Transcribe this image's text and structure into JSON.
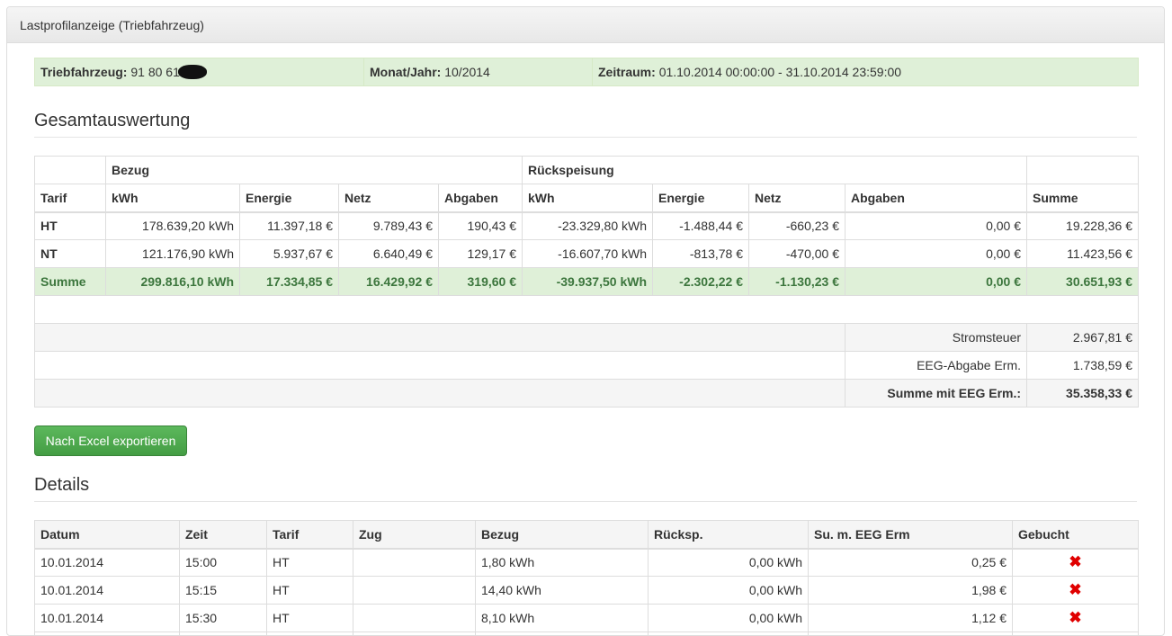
{
  "panel": {
    "title": "Lastprofilanzeige (Triebfahrzeug)"
  },
  "info": {
    "vehicle_label": "Triebfahrzeug:",
    "vehicle_value": "91 80 61",
    "month_label": "Monat/Jahr:",
    "month_value": "10/2014",
    "period_label": "Zeitraum:",
    "period_value": "01.10.2014 00:00:00 - 31.10.2014 23:59:00"
  },
  "summary": {
    "heading": "Gesamtauswertung",
    "group_headers": {
      "bezug": "Bezug",
      "rueck": "Rückspeisung"
    },
    "columns": [
      "Tarif",
      "kWh",
      "Energie",
      "Netz",
      "Abgaben",
      "kWh",
      "Energie",
      "Netz",
      "Abgaben",
      "Summe"
    ],
    "rows": [
      [
        "HT",
        "178.639,20 kWh",
        "11.397,18 €",
        "9.789,43 €",
        "190,43 €",
        "-23.329,80 kWh",
        "-1.488,44 €",
        "-660,23 €",
        "0,00 €",
        "19.228,36 €"
      ],
      [
        "NT",
        "121.176,90 kWh",
        "5.937,67 €",
        "6.640,49 €",
        "129,17 €",
        "-16.607,70 kWh",
        "-813,78 €",
        "-470,00 €",
        "0,00 €",
        "11.423,56 €"
      ]
    ],
    "sum_row": [
      "Summe",
      "299.816,10 kWh",
      "17.334,85 €",
      "16.429,92 €",
      "319,60 €",
      "-39.937,50 kWh",
      "-2.302,22 €",
      "-1.130,23 €",
      "0,00 €",
      "30.651,93 €"
    ],
    "extra": [
      {
        "label": "Stromsteuer",
        "value": "2.967,81 €"
      },
      {
        "label": "EEG-Abgabe Erm.",
        "value": "1.738,59 €"
      },
      {
        "label": "Summe mit EEG Erm.:",
        "value": "35.358,33 €"
      }
    ]
  },
  "export_button": "Nach Excel exportieren",
  "details": {
    "heading": "Details",
    "columns": [
      "Datum",
      "Zeit",
      "Tarif",
      "Zug",
      "Bezug",
      "Rücksp.",
      "Su. m. EEG Erm",
      "Gebucht"
    ],
    "rows": [
      [
        "10.01.2014",
        "15:00",
        "HT",
        "",
        "1,80 kWh",
        "0,00 kWh",
        "0,25 €",
        "✖"
      ],
      [
        "10.01.2014",
        "15:15",
        "HT",
        "",
        "14,40 kWh",
        "0,00 kWh",
        "1,98 €",
        "✖"
      ],
      [
        "10.01.2014",
        "15:30",
        "HT",
        "",
        "8,10 kWh",
        "0,00 kWh",
        "1,12 €",
        "✖"
      ],
      [
        "",
        "",
        "",
        "",
        "",
        "",
        "",
        ""
      ]
    ]
  },
  "colors": {
    "success_bg": "#dff0d8",
    "success_text": "#3c763d",
    "button": "#5cb85c",
    "cross": "#e00000"
  }
}
